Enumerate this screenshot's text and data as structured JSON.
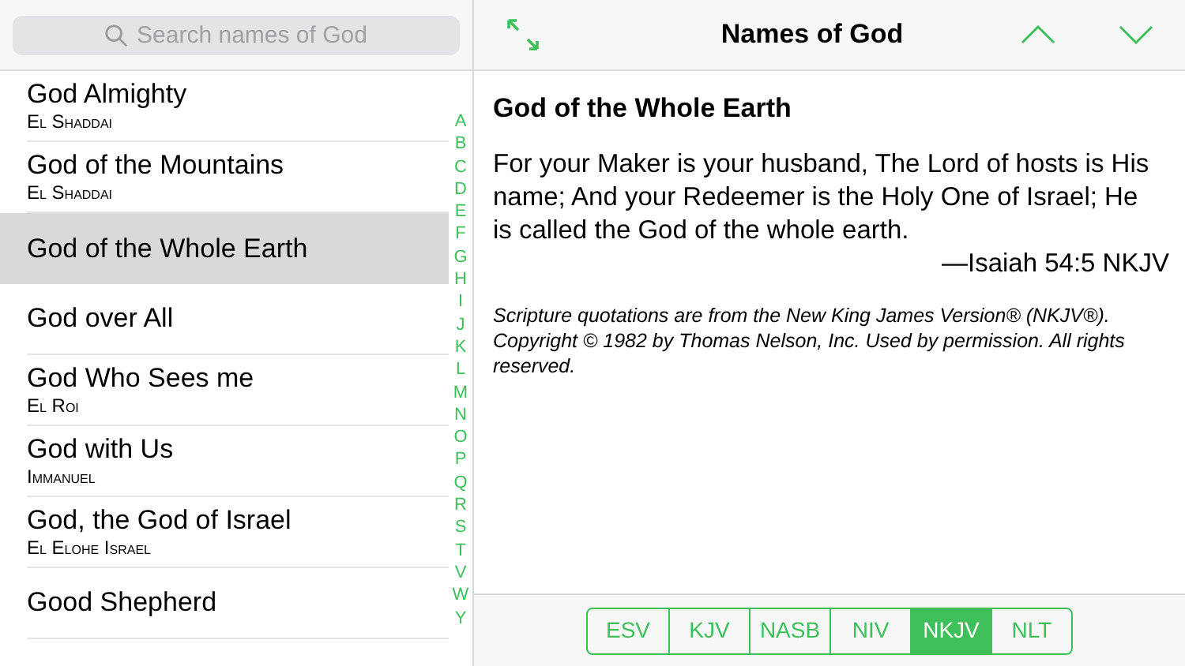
{
  "search": {
    "placeholder": "Search names of God"
  },
  "names": [
    {
      "name": "God Almighty",
      "hebrew": "El Shaddai",
      "selected": false
    },
    {
      "name": "God of the Mountains",
      "hebrew": "El Shaddai",
      "selected": false
    },
    {
      "name": "God of the Whole Earth",
      "selected": true
    },
    {
      "name": "God over All",
      "selected": false
    },
    {
      "name": "God Who Sees me",
      "hebrew": "El Roi",
      "selected": false
    },
    {
      "name": "God with Us",
      "hebrew": "Immanuel",
      "selected": false
    },
    {
      "name": "God, the God of Israel",
      "hebrew": "El Elohe Israel",
      "selected": false
    },
    {
      "name": "Good Shepherd",
      "selected": false
    }
  ],
  "index": [
    "A",
    "B",
    "C",
    "D",
    "E",
    "F",
    "G",
    "H",
    "I",
    "J",
    "K",
    "L",
    "M",
    "N",
    "O",
    "P",
    "Q",
    "R",
    "S",
    "T",
    "V",
    "W",
    "Y"
  ],
  "header": {
    "title": "Names of God"
  },
  "detail": {
    "title": "God of the Whole Earth",
    "verse": "For your Maker is your husband, The Lord of hosts is His name; And your Redeemer is the Holy One of Israel; He is called the God of the whole earth.",
    "reference": "—Isaiah 54:5 NKJV",
    "copyright": "Scripture quotations are from the New King James Version® (NKJV®). Copyright © 1982 by Thomas Nelson, Inc. Used by permission. All rights reserved."
  },
  "versions": [
    {
      "label": "ESV",
      "selected": false
    },
    {
      "label": "KJV",
      "selected": false
    },
    {
      "label": "NASB",
      "selected": false
    },
    {
      "label": "NIV",
      "selected": false
    },
    {
      "label": "NKJV",
      "selected": true
    },
    {
      "label": "NLT",
      "selected": false
    }
  ]
}
